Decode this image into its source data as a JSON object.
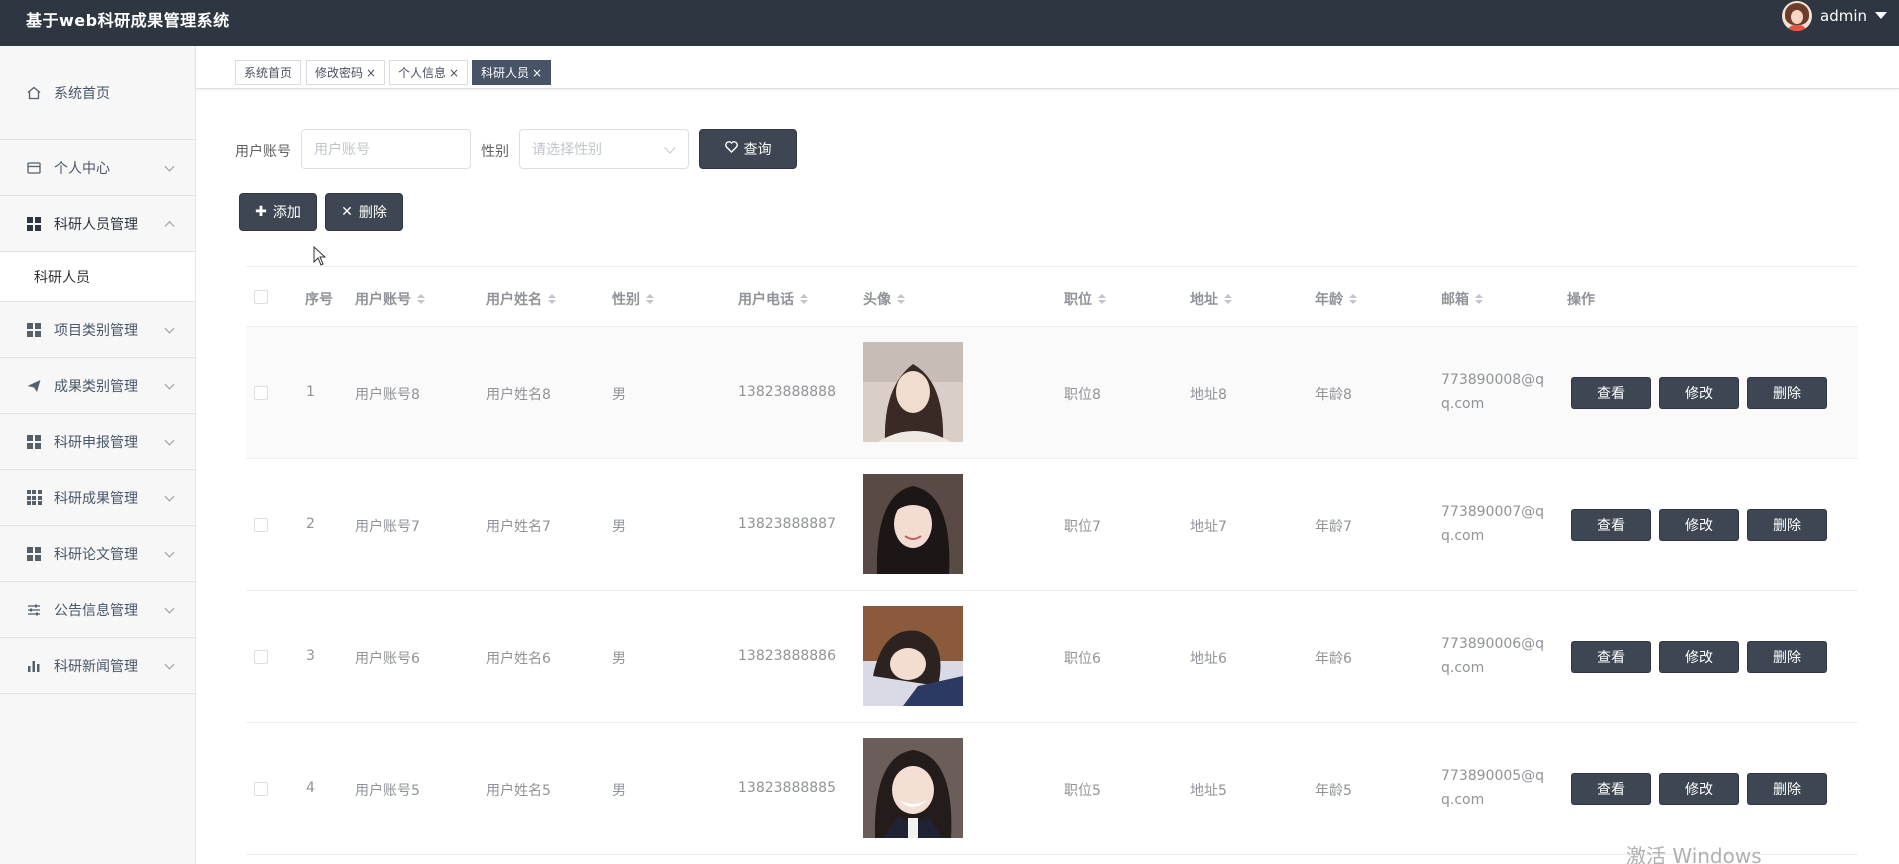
{
  "header": {
    "title": "基于web科研成果管理系统",
    "user": "admin"
  },
  "sidebar": {
    "items": [
      {
        "label": "系统首页",
        "icon": "home-icon"
      },
      {
        "label": "个人中心",
        "icon": "wallet-icon"
      },
      {
        "label": "科研人员管理",
        "icon": "grid-icon",
        "expanded": true
      },
      {
        "label": "项目类别管理",
        "icon": "grid-icon"
      },
      {
        "label": "成果类别管理",
        "icon": "send-icon"
      },
      {
        "label": "科研申报管理",
        "icon": "grid-icon"
      },
      {
        "label": "科研成果管理",
        "icon": "grid9-icon"
      },
      {
        "label": "科研论文管理",
        "icon": "grid-icon"
      },
      {
        "label": "公告信息管理",
        "icon": "sliders-icon"
      },
      {
        "label": "科研新闻管理",
        "icon": "bar-chart-icon"
      }
    ],
    "submenu": {
      "label": "科研人员"
    }
  },
  "tabs": [
    {
      "label": "系统首页",
      "closable": false,
      "active": false
    },
    {
      "label": "修改密码",
      "closable": true,
      "active": false
    },
    {
      "label": "个人信息",
      "closable": true,
      "active": false
    },
    {
      "label": "科研人员",
      "closable": true,
      "active": true
    }
  ],
  "search": {
    "account_label": "用户账号",
    "account_placeholder": "用户账号",
    "gender_label": "性别",
    "gender_placeholder": "请选择性别",
    "query_button": "查询"
  },
  "toolbar": {
    "add_label": "添加",
    "delete_label": "删除"
  },
  "table": {
    "columns": [
      "序号",
      "用户账号",
      "用户姓名",
      "性别",
      "用户电话",
      "头像",
      "职位",
      "地址",
      "年龄",
      "邮箱",
      "操作"
    ],
    "rows": [
      {
        "index": "1",
        "account": "用户账号8",
        "name": "用户姓名8",
        "gender": "男",
        "phone": "13823888888",
        "position": "职位8",
        "address": "地址8",
        "age": "年龄8",
        "email_line1": "773890008@q",
        "email_line2": "q.com"
      },
      {
        "index": "2",
        "account": "用户账号7",
        "name": "用户姓名7",
        "gender": "男",
        "phone": "13823888887",
        "position": "职位7",
        "address": "地址7",
        "age": "年龄7",
        "email_line1": "773890007@q",
        "email_line2": "q.com"
      },
      {
        "index": "3",
        "account": "用户账号6",
        "name": "用户姓名6",
        "gender": "男",
        "phone": "13823888886",
        "position": "职位6",
        "address": "地址6",
        "age": "年龄6",
        "email_line1": "773890006@q",
        "email_line2": "q.com"
      },
      {
        "index": "4",
        "account": "用户账号5",
        "name": "用户姓名5",
        "gender": "男",
        "phone": "13823888885",
        "position": "职位5",
        "address": "地址5",
        "age": "年龄5",
        "email_line1": "773890005@q",
        "email_line2": "q.com"
      }
    ],
    "actions": {
      "view": "查看",
      "edit": "修改",
      "delete": "删除"
    }
  },
  "watermark": "激活 Windows",
  "colors": {
    "topbar": "#2d3641",
    "button": "#3d4652",
    "active_tab": "#475366"
  }
}
